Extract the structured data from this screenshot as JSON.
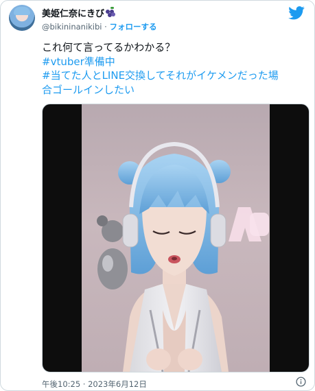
{
  "author": {
    "display_name": "美姫仁奈にきび",
    "handle": "@bikininanikibi",
    "separator": "·",
    "follow_label": "フォローする"
  },
  "tweet": {
    "line1": "これ何て言ってるかわかる？",
    "hashtag1": "#vtuber準備中",
    "line3": "#当てた人とLINE交換してそれがイケメンだった場",
    "line4": "合ゴールインしたい"
  },
  "meta": {
    "timestamp": "午後10:25 · 2023年6月12日"
  },
  "icons": {
    "logo": "twitter-bird-icon",
    "emoji": "grapes-icon",
    "info": "info-icon"
  },
  "colors": {
    "accent": "#1d9bf0",
    "text": "#0f1419",
    "muted": "#536471",
    "border": "#cfd9de"
  }
}
